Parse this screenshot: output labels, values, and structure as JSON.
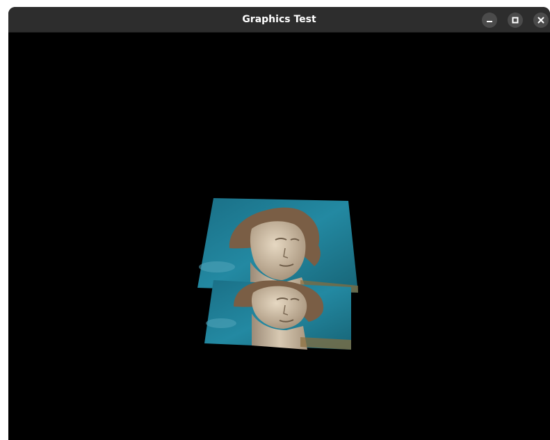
{
  "window": {
    "title": "Graphics Test",
    "buttons": {
      "minimize": "minimize-icon",
      "maximize": "maximize-icon",
      "close": "close-icon"
    }
  },
  "scene": {
    "background": "#000000",
    "texture": "statue-head-sky-photo",
    "colors": {
      "sky": "#1f7f96",
      "stone": "#c9b8a0",
      "moss": "#8a6e3c"
    }
  }
}
